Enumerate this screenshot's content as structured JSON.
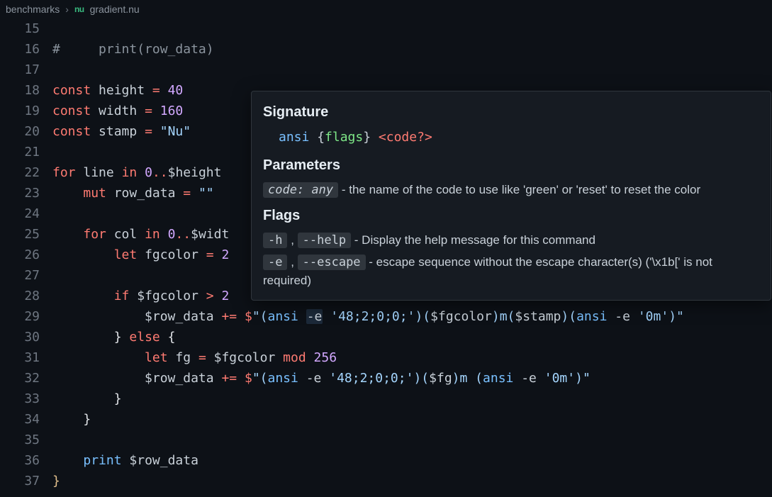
{
  "breadcrumb": {
    "folder": "benchmarks",
    "file_icon": "nu",
    "file": "gradient.nu"
  },
  "lines": {
    "start": 15,
    "count": 23
  },
  "code": {
    "l15": "",
    "l16_comment": "#     print(row_data)",
    "l17": "",
    "l18_kw": "const",
    "l18_id": "height",
    "l18_eq": "=",
    "l18_num": "40",
    "l19_kw": "const",
    "l19_id": "width",
    "l19_eq": "=",
    "l19_num": "160",
    "l20_kw": "const",
    "l20_id": "stamp",
    "l20_eq": "=",
    "l20_str": "\"Nu\"",
    "l22_for": "for",
    "l22_var": "line",
    "l22_in": "in",
    "l22_zero": "0",
    "l22_dots": "..",
    "l22_h": "$height",
    "l23_mut": "mut",
    "l23_var": "row_data",
    "l23_eq": "=",
    "l23_str": "\"\"",
    "l25_for": "for",
    "l25_var": "col",
    "l25_in": "in",
    "l25_zero": "0",
    "l25_dots": "..",
    "l25_w": "$widt",
    "l26_let": "let",
    "l26_var": "fgcolor",
    "l26_eq": "=",
    "l26_num": "2",
    "l28_if": "if",
    "l28_var": "$fgcolor",
    "l28_gt": ">",
    "l28_num": "2",
    "l29_rd": "$row_data",
    "l29_pe": "+=",
    "l29_d": "$",
    "l29_a": "\"(",
    "l29_ansi": "ansi",
    "l29_e": "-e",
    "l29_s1": "'48;2;0;0;'",
    "l29_p1": ")(",
    "l29_fg": "$fgcolor",
    "l29_p2": ")",
    "l29_m": "m(",
    "l29_st": "$stamp",
    "l29_p3": ")(",
    "l29_e2": "-e",
    "l29_s2": "'0m'",
    "l29_p4": ")",
    "l29_q": "\"",
    "l30_b": "}",
    "l30_else": "else",
    "l30_ob": "{",
    "l31_let": "let",
    "l31_fg": "fg",
    "l31_eq": "=",
    "l31_fgc": "$fgcolor",
    "l31_mod": "mod",
    "l31_n": "256",
    "l32_rd": "$row_data",
    "l32_pe": "+=",
    "l32_d": "$",
    "l32_a": "\"(",
    "l32_ansi": "ansi",
    "l32_e": "-e",
    "l32_s1": "'48;2;0;0;'",
    "l32_p1": ")(",
    "l32_fg": "$fg",
    "l32_p2": ")",
    "l32_m": "m (",
    "l32_e2": "-e",
    "l32_s2": "'0m'",
    "l32_p3": ")",
    "l32_q": "\"",
    "l33_b": "}",
    "l34_b": "}",
    "l36_print": "print",
    "l36_rd": "$row_data",
    "l37_b": "}"
  },
  "hover": {
    "h_sig": "Signature",
    "sig_ansi": "ansi",
    "sig_ob": " {",
    "sig_flags": "flags",
    "sig_cb": "} ",
    "sig_code": "<code?>",
    "h_params": "Parameters",
    "param_chip": "code: any",
    "param_desc": " - the name of the code to use like 'green' or 'reset' to reset the color",
    "h_flags": "Flags",
    "f1a": "-h",
    "f1b": "--help",
    "f1d": " - Display the help message for this command",
    "f2a": "-e",
    "f2b": "--escape",
    "f2d": " - escape sequence without the escape character(s) ('\\x1b[' is not required)",
    "comma": " , "
  }
}
